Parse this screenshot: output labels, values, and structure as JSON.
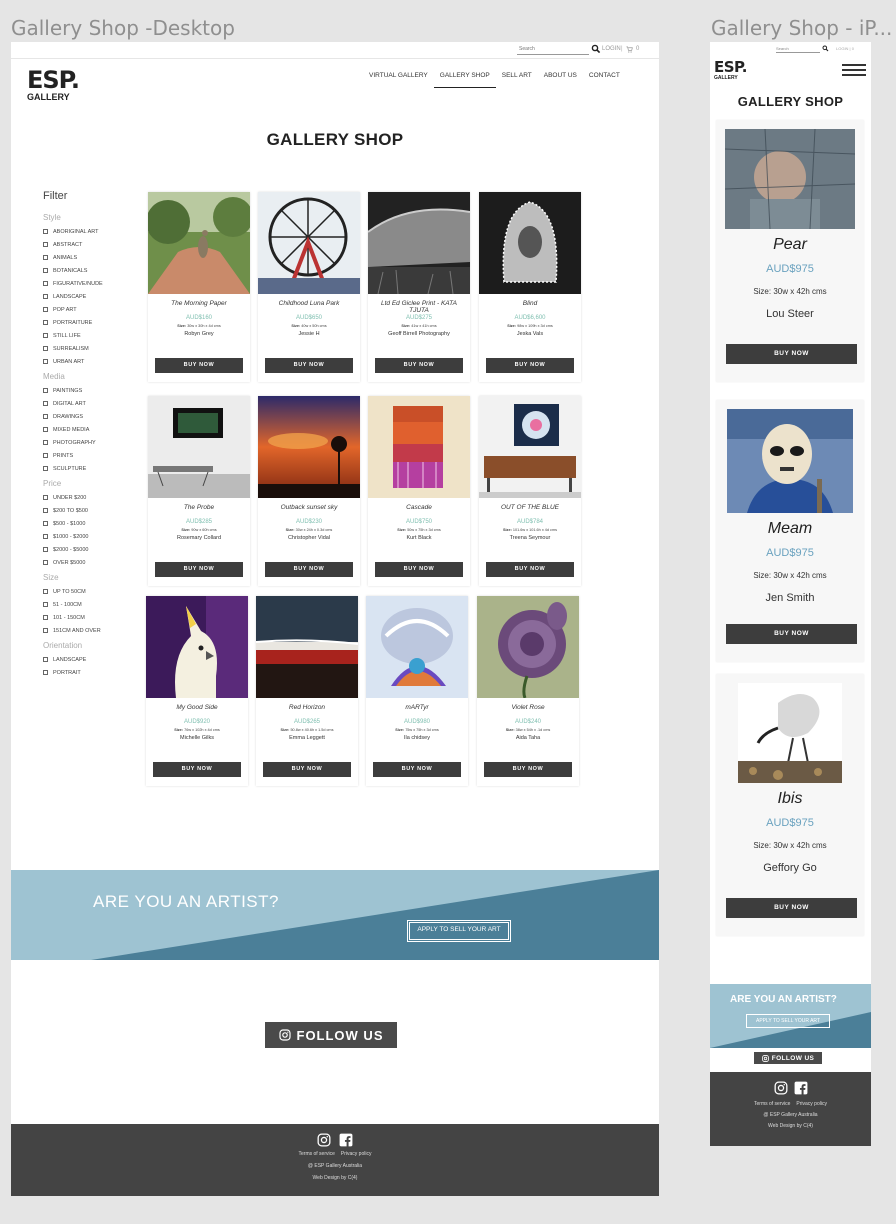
{
  "boards": {
    "desktop_title": "Gallery Shop -Desktop",
    "mobile_title": "Gallery Shop - iP..."
  },
  "header": {
    "search_placeholder": "Search",
    "login": "LOGIN",
    "divider": "|",
    "cart_count": "0",
    "logo_main": "ESP.",
    "logo_sub": "GALLERY",
    "nav": [
      "VIRTUAL GALLERY",
      "GALLERY SHOP",
      "SELL ART",
      "ABOUT US",
      "CONTACT"
    ],
    "active_nav": "GALLERY SHOP"
  },
  "page_title": "GALLERY SHOP",
  "filter": {
    "title": "Filter",
    "groups": [
      {
        "name": "Style",
        "options": [
          "ABORIGINAL ART",
          "ABSTRACT",
          "ANIMALS",
          "BOTANICALS",
          "FIGURATIVE/NUDE",
          "LANDSCAPE",
          "POP ART",
          "PORTRAITURE",
          "STILL LIFE",
          "SURREALISM",
          "URBAN ART"
        ]
      },
      {
        "name": "Media",
        "options": [
          "PAINTINGS",
          "DIGITAL ART",
          "DRAWINGS",
          "MIXED MEDIA",
          "PHOTOGRAPHY",
          "PRINTS",
          "SCULPTURE"
        ]
      },
      {
        "name": "Price",
        "options": [
          "UNDER $200",
          "$200 TO $500",
          "$500 - $1000",
          "$1000 - $2000",
          "$2000 - $5000",
          "OVER $5000"
        ]
      },
      {
        "name": "Size",
        "options": [
          "UP TO 50CM",
          "51 - 100CM",
          "101 - 150CM",
          "151CM AND OVER"
        ]
      },
      {
        "name": "Orientation",
        "options": [
          "LANDSCAPE",
          "PORTRAIT"
        ]
      }
    ]
  },
  "buy_label": "BUY NOW",
  "products": [
    {
      "name": "The Morning Paper",
      "price": "AUD$160",
      "size_label": "Size:",
      "size": "30w x 30h x 4d cms",
      "artist": "Robyn Grey",
      "art": "kangaroo"
    },
    {
      "name": "Childhood Luna Park",
      "price": "AUD$650",
      "size_label": "Size:",
      "size": "40w x 50h cms",
      "artist": "Jessie H",
      "art": "wheel"
    },
    {
      "name": "Ltd Ed Giclee Print - KATA TJUTA",
      "price": "AUD$275",
      "size_label": "Size:",
      "size": "41w x 41h cms",
      "artist": "Geoff Birrell Photography",
      "art": "rock"
    },
    {
      "name": "Blind",
      "price": "AUD$6,600",
      "size_label": "Size:",
      "size": "98w x 109h x 3d cms",
      "artist": "Jeska Vals",
      "art": "veil"
    },
    {
      "name": "The Probe",
      "price": "AUD$285",
      "size_label": "Size:",
      "size": "90w x 60h cms",
      "artist": "Rosemary Collard",
      "art": "room"
    },
    {
      "name": "Outback sunset sky",
      "price": "AUD$230",
      "size_label": "Size:",
      "size": "30w x 24h x 0.3d cms",
      "artist": "Christopher Vidal",
      "art": "sunset"
    },
    {
      "name": "Cascade",
      "price": "AUD$750",
      "size_label": "Size:",
      "size": "50w x 75h x 3d cms",
      "artist": "Kurt Black",
      "art": "cascade"
    },
    {
      "name": "OUT OF THE BLUE",
      "price": "AUD$784",
      "size_label": "Size:",
      "size": "101.6w x 101.6h x 4d cms",
      "artist": "Treena Seymour",
      "art": "protea"
    },
    {
      "name": "My Good Side",
      "price": "AUD$920",
      "size_label": "Size:",
      "size": "76w x 102h x 4d cms",
      "artist": "Michelle Gilks",
      "art": "cockatoo"
    },
    {
      "name": "Red Horizon",
      "price": "AUD$265",
      "size_label": "Size:",
      "size": "50.8w x 40.6h x 1.5d cms",
      "artist": "Emma Leggett",
      "art": "horizon"
    },
    {
      "name": "mARTyr",
      "price": "AUD$980",
      "size_label": "Size:",
      "size": "75w x 75h x 3d cms",
      "artist": "Ila chidsey",
      "art": "martyr"
    },
    {
      "name": "Violet Rose",
      "price": "AUD$240",
      "size_label": "Size:",
      "size": "38w x 54h x .1d cms",
      "artist": "Aida Taha",
      "art": "rose"
    }
  ],
  "artist_banner": {
    "heading": "ARE YOU AN ARTIST?",
    "button": "APPLY TO SELL YOUR ART"
  },
  "follow": "FOLLOW US",
  "footer": {
    "terms": "Terms of service",
    "privacy": "Privacy policy",
    "copyright": "@ ESP Gallery Australia",
    "credit": "Web Design by C(4)"
  },
  "mobile": {
    "search_placeholder": "Search",
    "login": "LOGIN | 0",
    "title": "GALLERY SHOP",
    "products": [
      {
        "name": "Pear",
        "price": "AUD$975",
        "size": "Size: 30w x 42h cms",
        "artist": "Lou Steer"
      },
      {
        "name": "Meam",
        "price": "AUD$975",
        "size": "Size: 30w x 42h cms",
        "artist": "Jen  Smith"
      },
      {
        "name": "Ibis",
        "price": "AUD$975",
        "size": "Size: 30w x 42h cms",
        "artist": "Geffory Go"
      }
    ]
  },
  "colors": {
    "accent_price": "#7fbfb0",
    "banner_light": "#9ec3d2",
    "banner_dark": "#4b7f98",
    "dark": "#444444"
  }
}
